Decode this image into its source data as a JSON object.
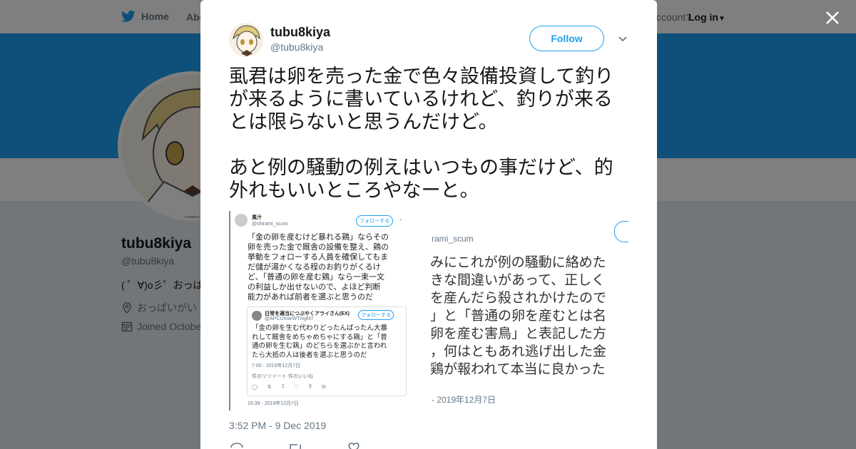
{
  "background": {
    "nav": {
      "home_label": "Home",
      "about_label": "Abo",
      "account_text": "ccount?",
      "login_label": "Log in"
    },
    "profile": {
      "name": "tubu8kiya",
      "handle": "@tubu8kiya",
      "bio": "( ゜∀)o彡゜おっぱ",
      "location": "おっぱいがい",
      "joined": "Joined Octobe"
    },
    "colors": {
      "banner": "#1da1f2"
    }
  },
  "modal": {
    "user": {
      "name": "tubu8kiya",
      "handle": "@tubu8kiya"
    },
    "follow_label": "Follow",
    "tweet_text": "虱君は卵を売った金で色々設備投資して釣りが来るように書いているけれど、釣りが来るとは限らないと思うんだけど。\n\nあと例の騒動の例えはいつもの事だけど、的外れもいいところやなーと。",
    "timestamp": "3:52 PM - 9 Dec 2019",
    "media_left": {
      "name": "風汁",
      "handle": "@shirami_scum",
      "follow": "フォローする",
      "body": "「金の卵を産むけど暴れる鶏」ならその\n卵を売った金で厩舎の設備を整え、鶏の\n挙動をフォローする人員を確保してもま\nだ儲が湯かくなる程のお釣りがくるけ\nど、「普通の卵を産む鶏」なら一束一文\nの利益しか出せないので、よほど判断\n能力があれば前者を選ぶと思うのだ",
      "quoted_name": "日常を適当につぶやくアライさん(EX)",
      "quoted_handle": "@APCUmarWTnight7",
      "quoted_follow": "フォローする",
      "quoted_body": "「金の卵を生む代わりどったんばったん大暴\nれして厩舎をめちゃめちゃにする鶏」と「普\n通の卵を生む鶏」のどちらを選ぶかと言われ\nたら大抵の人は後者を選ぶと思うのだ",
      "quoted_time": "7:00 - 2019年12月7日",
      "retweets_label": "件のリツイート 件のいいね",
      "reply_count": "2",
      "like_count": "9",
      "time": "16:39 - 2019年12月7日"
    },
    "media_right": {
      "handle": "rami_scum",
      "body": "みにこれが例の騒動に絡めた\nきな間違いがあって、正しく\nを産んだら殺されかけたので\n」と「普通の卵を産むとは名\n卵を産む害鳥」と表記した方\n，何はともあれ逃げ出した金\n鶏が報われて本当に良かった",
      "time": "- 2019年12月7日"
    }
  }
}
